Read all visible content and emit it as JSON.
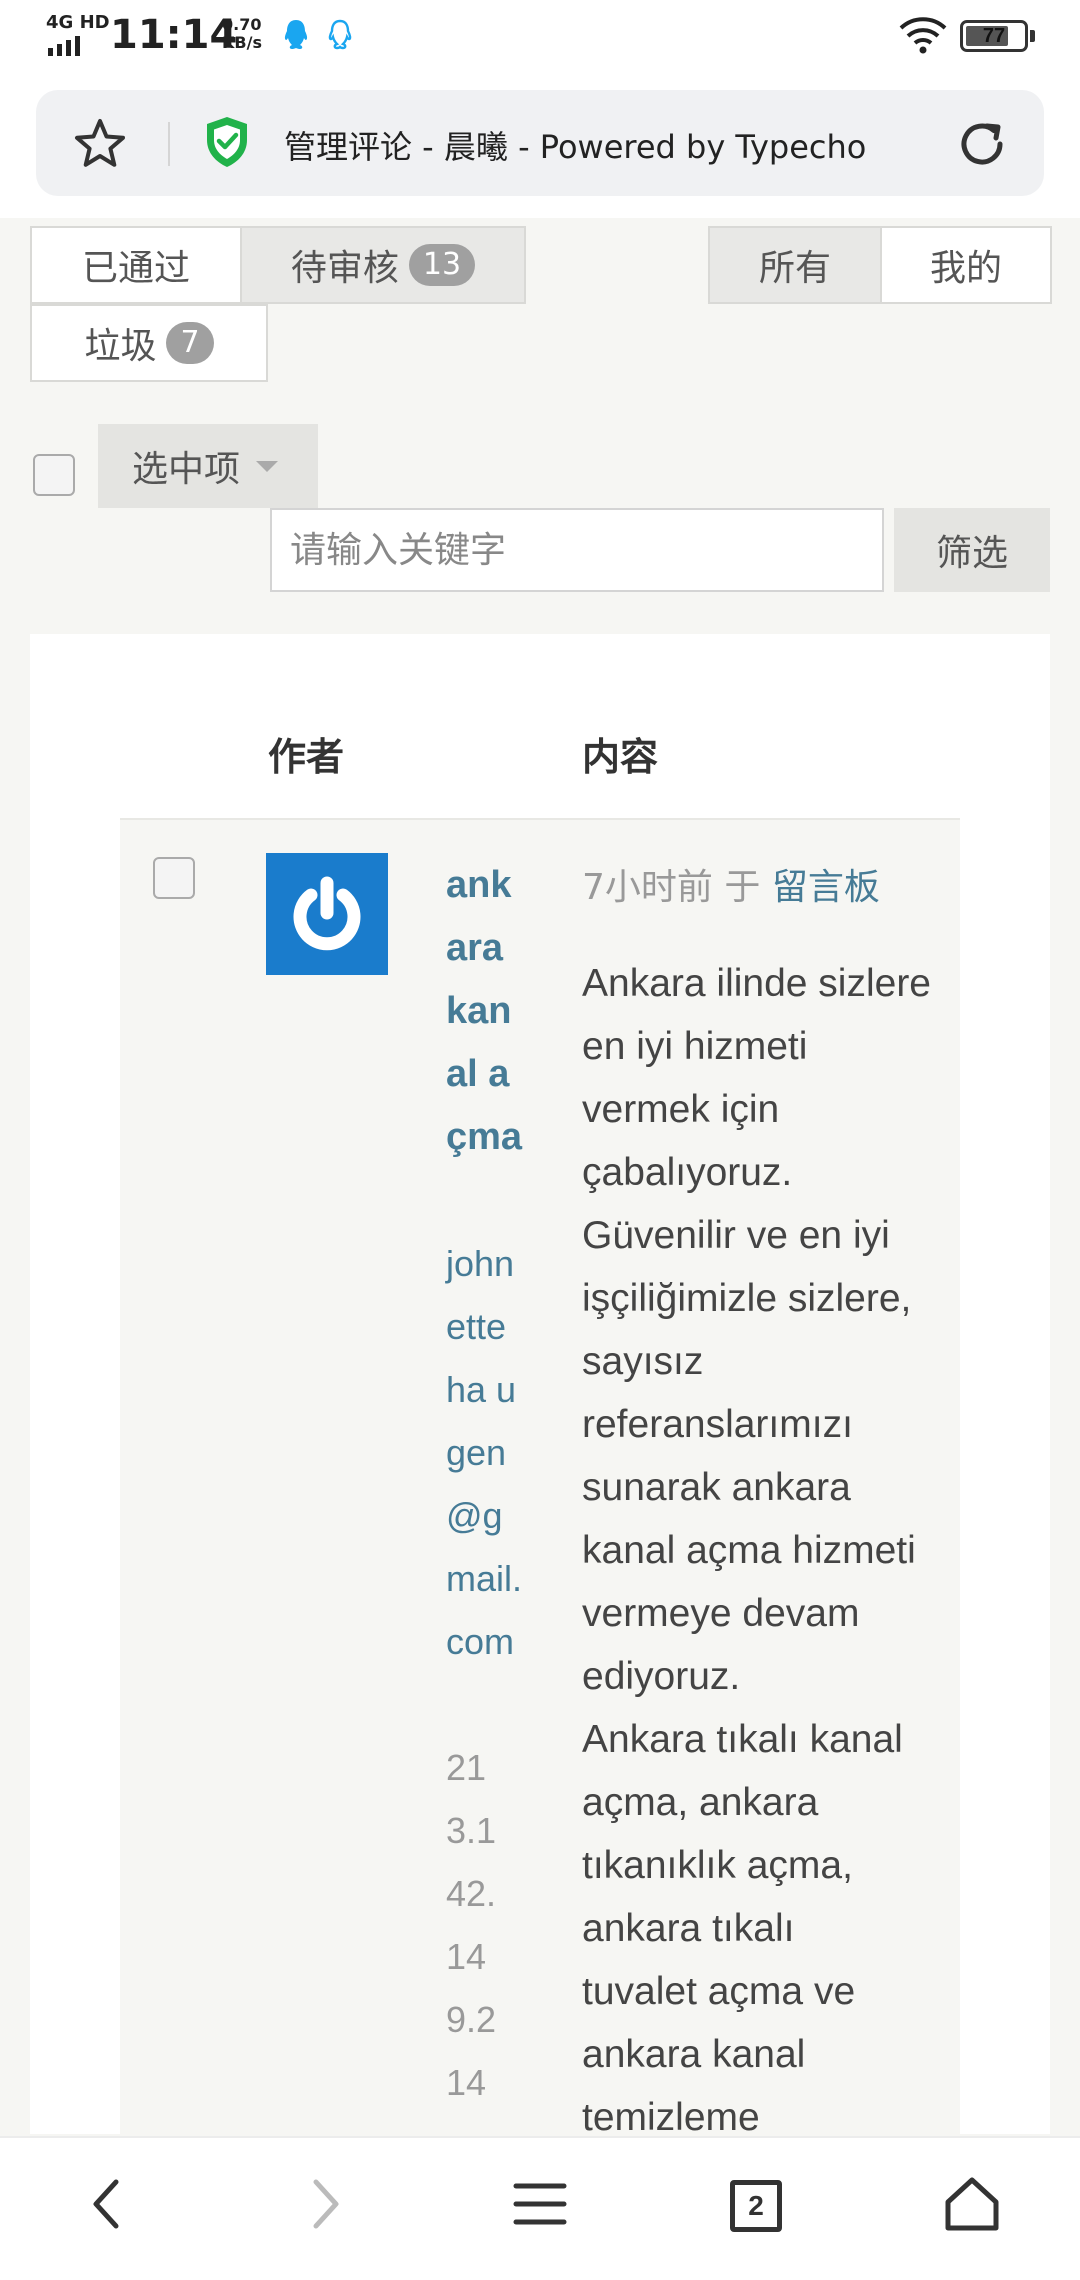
{
  "status_bar": {
    "network": "4G HD",
    "time": "11:14",
    "speed_value": "0.70",
    "speed_unit": "KB/s",
    "battery": "77",
    "battery_level": 0.77,
    "icons": [
      "signal-icon",
      "qq-icon",
      "qq-outline-icon",
      "wifi-icon",
      "battery-icon"
    ]
  },
  "browser": {
    "page_title": "管理评论 - 晨曦 - Powered by Typecho",
    "icons": [
      "star-icon",
      "shield-icon",
      "reload-icon"
    ],
    "accent": "#21b24a"
  },
  "tabs": {
    "approved": "已通过",
    "pending": "待审核",
    "pending_count": "13",
    "spam": "垃圾",
    "spam_count": "7",
    "all": "所有",
    "mine": "我的"
  },
  "filter": {
    "selected_label": "选中项",
    "search_placeholder": "请输入关键字",
    "filter_button": "筛选"
  },
  "table": {
    "col_author": "作者",
    "col_content": "内容"
  },
  "comment": {
    "author": "ankara kanal açma",
    "email": "johnetteha ugen@gmail.com",
    "ip": "213.142.149.214",
    "time": "7小时前 于",
    "post": "留言板",
    "text": "Ankara ilinde sizlere en iyi hizmeti vermek için çabalıyoruz.\nGüvenilir ve en iyi işçiliğimizle sizlere, sayısız referanslarımızı sunarak ankara kanal açma hizmeti vermeye devam ediyoruz.\nAnkara tıkalı kanal açma, ankara tıkanıklık açma, ankara tıkalı\ntuvalet açma ve ankara kanal temizleme alanlarında ustalıkla sizlere en iyi"
  },
  "bottom_nav": {
    "tab_count": "2",
    "icons": [
      "back-icon",
      "forward-icon",
      "menu-icon",
      "tabs-icon",
      "home-icon"
    ]
  },
  "colors": {
    "link": "#467b96",
    "avatar_bg": "#1a7ccc"
  }
}
